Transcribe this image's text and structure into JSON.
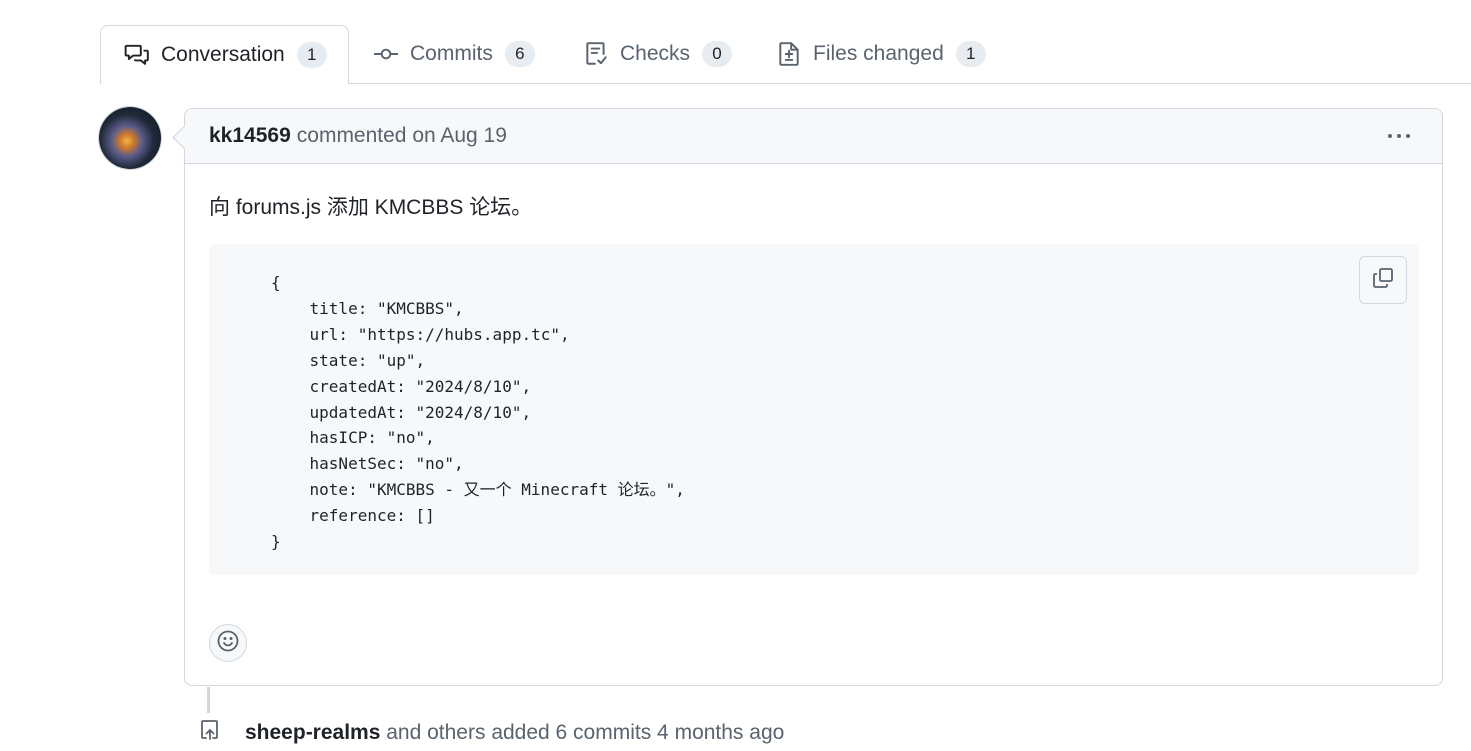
{
  "tabs": [
    {
      "label": "Conversation",
      "count": "1",
      "icon": "comment-discussion-icon",
      "active": true
    },
    {
      "label": "Commits",
      "count": "6",
      "icon": "git-commit-icon"
    },
    {
      "label": "Checks",
      "count": "0",
      "icon": "checklist-icon"
    },
    {
      "label": "Files changed",
      "count": "1",
      "icon": "file-diff-icon"
    }
  ],
  "comment": {
    "author": "kk14569",
    "meta": "commented on Aug 19",
    "body": "向 forums.js 添加 KMCBBS 论坛。",
    "code": "{\n    title: \"KMCBBS\",\n    url: \"https://hubs.app.tc\",\n    state: \"up\",\n    createdAt: \"2024/8/10\",\n    updatedAt: \"2024/8/10\",\n    hasICP: \"no\",\n    hasNetSec: \"no\",\n    note: \"KMCBBS - 又一个 Minecraft 论坛。\",\n    reference: []\n}"
  },
  "event": {
    "actor": "sheep-realms",
    "text": " and others added 6 commits 4 months ago"
  },
  "colors": {
    "border": "#d0d7de",
    "muted_text": "#59636e",
    "header_bg": "#f6f8fa",
    "counter_bg": "#e7ecf0"
  }
}
